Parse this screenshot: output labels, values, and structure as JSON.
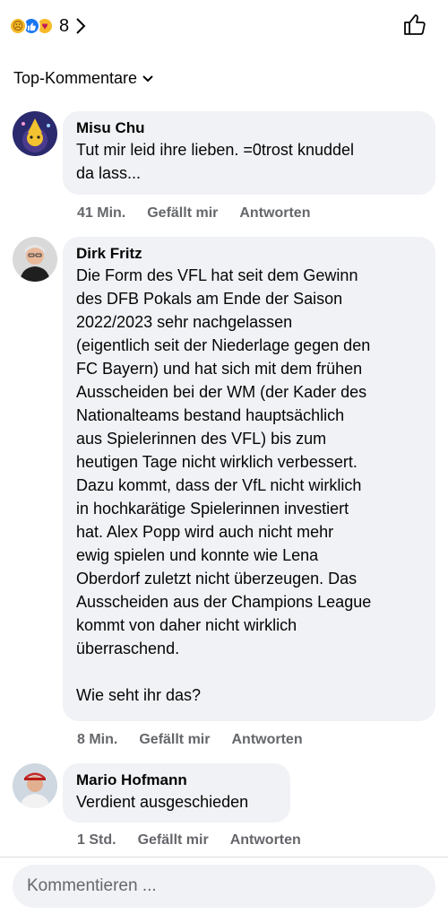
{
  "header": {
    "reaction_count": "8",
    "reactions": [
      "sad",
      "like",
      "care"
    ]
  },
  "sort": {
    "label": "Top-Kommentare"
  },
  "comments": [
    {
      "author": "Misu Chu",
      "text": "Tut mir leid ihre lieben. =0trost knuddel\nda lass...",
      "time": "41 Min.",
      "like_label": "Gefällt mir",
      "reply_label": "Antworten"
    },
    {
      "author": "Dirk Fritz",
      "text": "Die Form des VFL hat seit dem Gewinn\ndes DFB Pokals am Ende der Saison\n2022/2023 sehr nachgelassen\n(eigentlich seit der Niederlage gegen den\nFC Bayern) und hat sich mit dem frühen\nAusscheiden bei der WM (der Kader des\nNationalteams bestand hauptsächlich\naus Spielerinnen des VFL) bis zum\nheutigen Tage nicht wirklich verbessert.\nDazu kommt, dass der VfL nicht wirklich\nin hochkarätige Spielerinnen investiert\nhat. Alex Popp wird auch nicht mehr\newig spielen und konnte wie Lena\nOberdorf zuletzt nicht überzeugen. Das\nAusscheiden aus der Champions League\nkommt von daher nicht wirklich\nüberraschend.\n\nWie seht ihr das?",
      "time": "8 Min.",
      "like_label": "Gefällt mir",
      "reply_label": "Antworten"
    },
    {
      "author": "Mario Hofmann",
      "text": "Verdient ausgeschieden",
      "time": "1 Std.",
      "like_label": "Gefällt mir",
      "reply_label": "Antworten"
    }
  ],
  "composer": {
    "placeholder": "Kommentieren ..."
  },
  "colors": {
    "bubble": "#f0f2f5",
    "meta_text": "#65676b",
    "like_blue": "#1877f2"
  }
}
